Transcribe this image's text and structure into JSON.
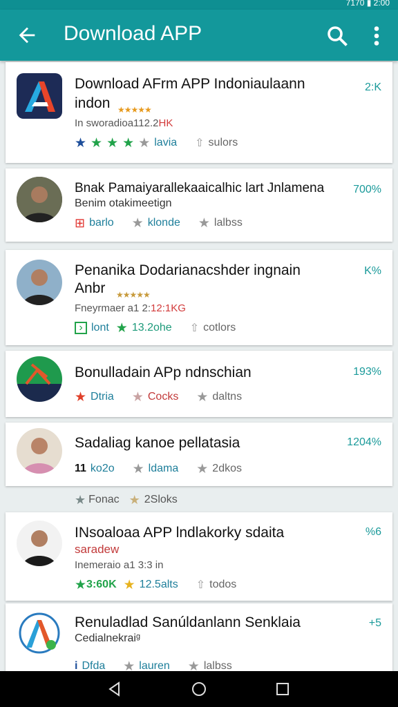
{
  "status": {
    "right_text": "7170 ▮ 2:00"
  },
  "appbar": {
    "title": "Download APP"
  },
  "cards": [
    {
      "title": "Download AFrm APP Indoniaulaann",
      "subtitle": "indon",
      "size": "2:K",
      "meta": "In sworadioa112.2",
      "meta_red": "HK",
      "chips": [
        {
          "label": "lavia"
        }
      ],
      "share": "sulors"
    },
    {
      "title": "Bnak Pamaiyarallekaaicalhic lart Jnlamena",
      "subtitle": "Benim otakimeetign",
      "size": "700%",
      "chips": [
        {
          "label": "barlo"
        },
        {
          "label": "klonde"
        }
      ],
      "share": "lalbss"
    },
    {
      "title": "Penanika Dodarianacshder ingnain",
      "subtitle": "Anbr",
      "size": "K%",
      "meta": "Fneyrmaer a1 2:",
      "meta_red": "12:1KG",
      "chips": [
        {
          "label": "lont"
        },
        {
          "label": "13.2ohe"
        }
      ],
      "share": "cotlors"
    },
    {
      "title": "Bonulladain APp ndnschian",
      "size": "193%",
      "chips": [
        {
          "label": "Dtria"
        },
        {
          "label": "Cocks"
        }
      ],
      "share": "daltns"
    },
    {
      "title": "Sadaliag kanoe pellatasia",
      "size": "1204%",
      "chips": [
        {
          "label": "ko2o"
        },
        {
          "label": "ldama"
        }
      ],
      "share": "2dkos"
    },
    {
      "title": "INsoaloaa APP lndlakorky sdaita",
      "subtitle": "saradew",
      "size": "%6",
      "meta": "Inemeraio a1 3:3 i",
      "meta_red": "n",
      "chips": [
        {
          "label": "3:60K"
        },
        {
          "label": "12.5alts"
        }
      ],
      "share": "todos"
    },
    {
      "title": "Renuladlad Sanúldanlann Senklaia",
      "subtitle": "Cedialnekraiᵍ",
      "size": "+5",
      "chips": [
        {
          "label": "Dfda"
        },
        {
          "label": "lauren"
        }
      ],
      "share": "lalbss"
    }
  ],
  "divider": {
    "left": "Fonac",
    "right": "2Sloks"
  }
}
